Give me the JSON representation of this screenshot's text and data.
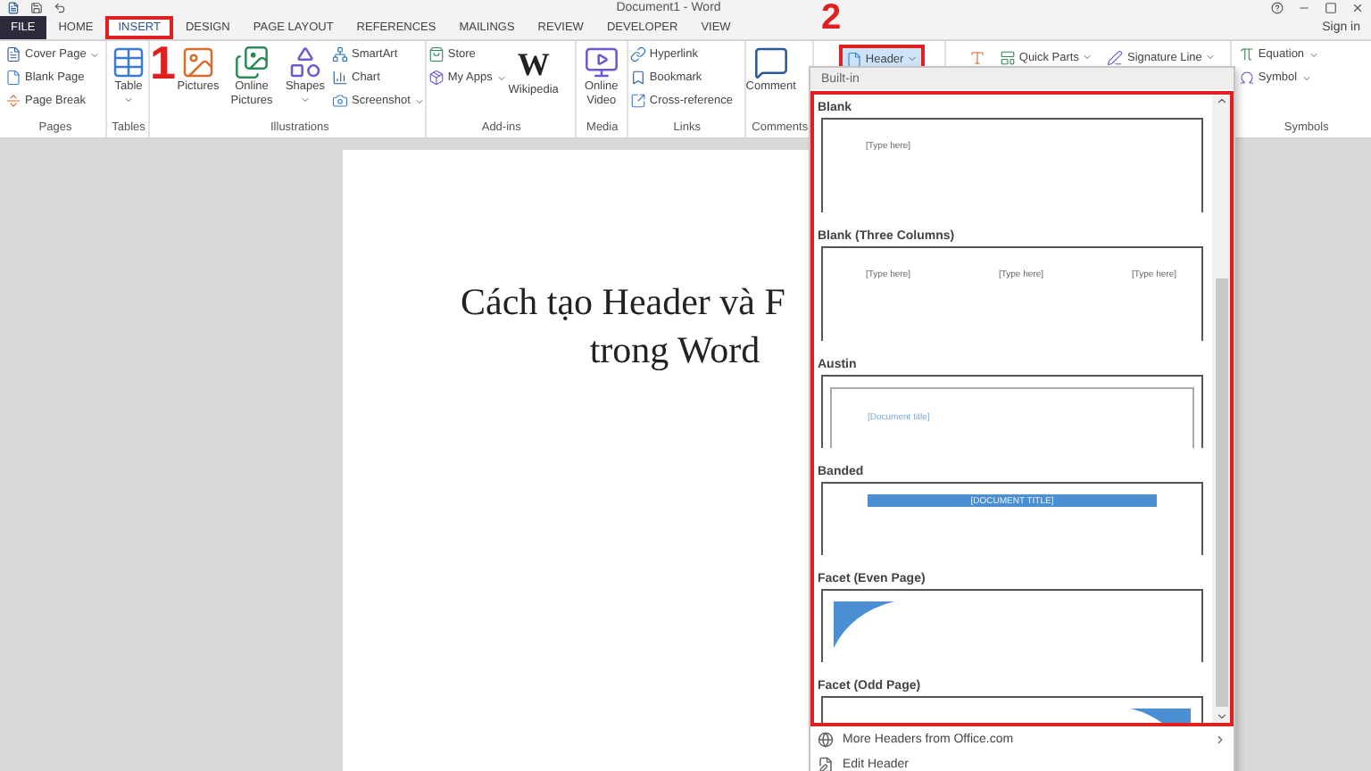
{
  "title_bar": {
    "title": "Document1 - Word"
  },
  "tabs": [
    {
      "label": "FILE",
      "kind": "file",
      "selected": false,
      "annotated": false
    },
    {
      "label": "HOME",
      "kind": "tab",
      "selected": false,
      "annotated": false
    },
    {
      "label": "INSERT",
      "kind": "tab",
      "selected": true,
      "annotated": true
    },
    {
      "label": "DESIGN",
      "kind": "tab",
      "selected": false,
      "annotated": false
    },
    {
      "label": "PAGE LAYOUT",
      "kind": "tab",
      "selected": false,
      "annotated": false
    },
    {
      "label": "REFERENCES",
      "kind": "tab",
      "selected": false,
      "annotated": false
    },
    {
      "label": "MAILINGS",
      "kind": "tab",
      "selected": false,
      "annotated": false
    },
    {
      "label": "REVIEW",
      "kind": "tab",
      "selected": false,
      "annotated": false
    },
    {
      "label": "DEVELOPER",
      "kind": "tab",
      "selected": false,
      "annotated": false
    },
    {
      "label": "VIEW",
      "kind": "tab",
      "selected": false,
      "annotated": false
    }
  ],
  "sign_in": "Sign in",
  "ribbon": {
    "groups": [
      {
        "label": "Pages",
        "items": [
          {
            "label": "Cover Page",
            "kind": "small",
            "dropdown": true
          },
          {
            "label": "Blank Page",
            "kind": "small",
            "dropdown": false
          },
          {
            "label": "Page Break",
            "kind": "small",
            "dropdown": false
          }
        ]
      },
      {
        "label": "Tables",
        "items": [
          {
            "label": "Table",
            "kind": "large",
            "dropdown": true
          }
        ]
      },
      {
        "label": "Illustrations",
        "items": [
          {
            "label": "Pictures",
            "kind": "large",
            "dropdown": false
          },
          {
            "label": "Online Pictures",
            "kind": "large",
            "dropdown": false
          },
          {
            "label": "Shapes",
            "kind": "large",
            "dropdown": true
          },
          {
            "label": "SmartArt",
            "kind": "small",
            "dropdown": false
          },
          {
            "label": "Chart",
            "kind": "small",
            "dropdown": false
          },
          {
            "label": "Screenshot",
            "kind": "small",
            "dropdown": true
          }
        ]
      },
      {
        "label": "Add-ins",
        "items": [
          {
            "label": "Store",
            "kind": "small",
            "dropdown": false
          },
          {
            "label": "My Apps",
            "kind": "small",
            "dropdown": true
          },
          {
            "label": "Wikipedia",
            "kind": "large",
            "dropdown": false,
            "logo": "W"
          }
        ]
      },
      {
        "label": "Media",
        "items": [
          {
            "label": "Online Video",
            "kind": "large",
            "dropdown": false
          }
        ]
      },
      {
        "label": "Links",
        "items": [
          {
            "label": "Hyperlink",
            "kind": "small",
            "dropdown": false
          },
          {
            "label": "Bookmark",
            "kind": "small",
            "dropdown": false
          },
          {
            "label": "Cross-reference",
            "kind": "small",
            "dropdown": false
          }
        ]
      },
      {
        "label": "Comments",
        "items": [
          {
            "label": "Comment",
            "kind": "large",
            "dropdown": false
          }
        ]
      },
      {
        "items": [
          {
            "label": "Header",
            "kind": "inline",
            "dropdown": true,
            "annotated": true
          }
        ]
      },
      {
        "items": [
          {
            "kind": "inline",
            "dropdown": false,
            "annotated": false
          },
          {
            "label": "Quick Parts",
            "kind": "inline",
            "dropdown": true,
            "annotated": false
          },
          {
            "label": "Signature Line",
            "kind": "inline",
            "dropdown": true,
            "annotated": false
          }
        ]
      },
      {
        "label": "Symbols",
        "items": [
          {
            "label": "Equation",
            "kind": "small",
            "dropdown": true
          },
          {
            "label": "Symbol",
            "kind": "small",
            "dropdown": true
          }
        ]
      }
    ]
  },
  "annotations": [
    {
      "label": "1"
    },
    {
      "label": "2"
    }
  ],
  "document": {
    "title_lines": [
      "Cách tạo Header và F",
      "trong Word"
    ]
  },
  "header_menu": {
    "section": "Built-in",
    "gallery": [
      {
        "label": "Blank",
        "kind": "blank",
        "texts": [
          "[Type here]"
        ]
      },
      {
        "label": "Blank (Three Columns)",
        "kind": "three_columns",
        "texts": [
          "[Type here]",
          "[Type here]",
          "[Type here]"
        ]
      },
      {
        "label": "Austin",
        "kind": "austin",
        "texts": [
          "[Document title]"
        ]
      },
      {
        "label": "Banded",
        "kind": "banded",
        "texts": [
          "[DOCUMENT TITLE]"
        ]
      },
      {
        "label": "Facet (Even Page)",
        "kind": "facet_even"
      },
      {
        "label": "Facet (Odd Page)",
        "kind": "facet_odd"
      }
    ],
    "commands": [
      {
        "label": "More Headers from Office.com",
        "submenu": true
      },
      {
        "label": "Edit Header",
        "submenu": false
      }
    ]
  }
}
